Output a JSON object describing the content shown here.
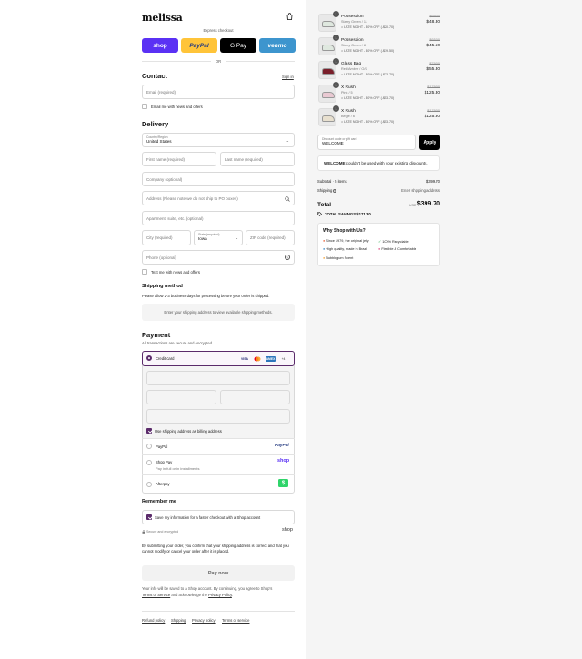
{
  "brand": "melissa",
  "express_checkout": "Express checkout",
  "express": {
    "shop": "shop",
    "paypal": "PayPal",
    "gpay": "G Pay",
    "venmo": "venmo"
  },
  "or": "OR",
  "contact": {
    "title": "Contact",
    "sign_in": "Sign in",
    "email_placeholder": "Email (required)",
    "news_label": "Email me with news and offers"
  },
  "delivery": {
    "title": "Delivery",
    "country_label": "Country/Region",
    "country_value": "United States",
    "first_name": "First name (required)",
    "last_name": "Last name (required)",
    "company": "Company (optional)",
    "address": "Address (Please note we do not ship to PO boxes)",
    "apartment": "Apartment, suite, etc. (optional)",
    "city": "City (required)",
    "state_label": "State (required)",
    "state_value": "Iowa",
    "zip": "ZIP code (required)",
    "phone": "Phone (optional)",
    "text_label": "Text me with news and offers"
  },
  "shipping_method": {
    "title": "Shipping method",
    "note": "Please allow 2-3 business days for processing before your order is shipped.",
    "placeholder": "Enter your shipping address to view available shipping methods."
  },
  "payment": {
    "title": "Payment",
    "subtitle": "All transactions are secure and encrypted.",
    "credit_card": "Credit card",
    "cards": {
      "visa": "VISA",
      "amex": "AMEX",
      "more": "+4"
    },
    "billing_label": "Use shipping address as billing address",
    "paypal": "PayPal",
    "paypal_logo": "PayPal",
    "shop_pay": "Shop Pay",
    "shop_pay_sub": "Pay in full or in installments",
    "shop_pay_logo": "shop",
    "afterpay": "Afterpay",
    "afterpay_logo": "$"
  },
  "remember": {
    "title": "Remember me",
    "save_label": "Save my information for a faster checkout with a Shop account",
    "secure": "Secure and encrypted",
    "shop_logo": "shop"
  },
  "legal": "By submitting your order, you confirm that your shipping address is correct and that you cannot modify or cancel your order after it is placed.",
  "pay_now": "Pay now",
  "shop_note_pre": "Your info will be saved to a Shop account. By continuing, you agree to Shop's",
  "terms_of_service": "Terms of Service",
  "shop_note_mid": "and acknowledge the",
  "privacy_policy": "Privacy Policy",
  "footer": [
    "Refund policy",
    "Shipping",
    "Privacy policy",
    "Terms of service"
  ],
  "items": [
    {
      "qty": "1",
      "name": "Possession",
      "variant": "Starry Green / 11",
      "discount": "LATE NIGHT - 30% OFF (-$20.70)",
      "old": "$69.00",
      "price": "$48.30",
      "color": "#dfe8df"
    },
    {
      "qty": "1",
      "name": "Possession",
      "variant": "Starry Green / 8",
      "discount": "LATE NIGHT - 30% OFF (-$19.50)",
      "old": "$65.00",
      "price": "$45.50",
      "color": "#dfe8df"
    },
    {
      "qty": "1",
      "name": "Glass Bag",
      "variant": "Red/Amber / O/S",
      "discount": "LATE NIGHT - 30% OFF (-$23.70)",
      "old": "$79.00",
      "price": "$55.30",
      "color": "#7a1f2b"
    },
    {
      "qty": "1",
      "name": "X Rush",
      "variant": "Pink / 5",
      "discount": "LATE NIGHT - 30% OFF (-$53.70)",
      "old": "$179.00",
      "price": "$125.30",
      "color": "#e9c9d2"
    },
    {
      "qty": "1",
      "name": "X Rush",
      "variant": "Beige / 6",
      "discount": "LATE NIGHT - 30% OFF (-$53.70)",
      "old": "$179.00",
      "price": "$125.30",
      "color": "#e8e0cf"
    }
  ],
  "discount": {
    "label": "Discount code or gift card",
    "value": "WELCOME",
    "apply": "Apply",
    "msg_code": "WELCOME",
    "msg_rest": "couldn't be used with your existing discounts."
  },
  "totals": {
    "subtotal_label": "Subtotal · 5 items",
    "subtotal": "$399.70",
    "shipping_label": "Shipping",
    "shipping": "Enter shipping address",
    "total_label": "Total",
    "currency": "USD",
    "total": "$399.70",
    "savings_label": "TOTAL SAVINGS",
    "savings": "$171.30"
  },
  "why": {
    "title": "Why Shop with Us?",
    "points": [
      "Since 1979, the original jelly",
      "100% Recyclable",
      "High quality, made in Brazil",
      "Flexible & Comfortable",
      "Bubblegum Scent"
    ]
  },
  "colors": {
    "accent": "#5b2b6b",
    "shop": "#5a31f4",
    "paypal": "#ffc439",
    "venmo": "#3d95ce",
    "afterpay": "#2fd46a"
  }
}
